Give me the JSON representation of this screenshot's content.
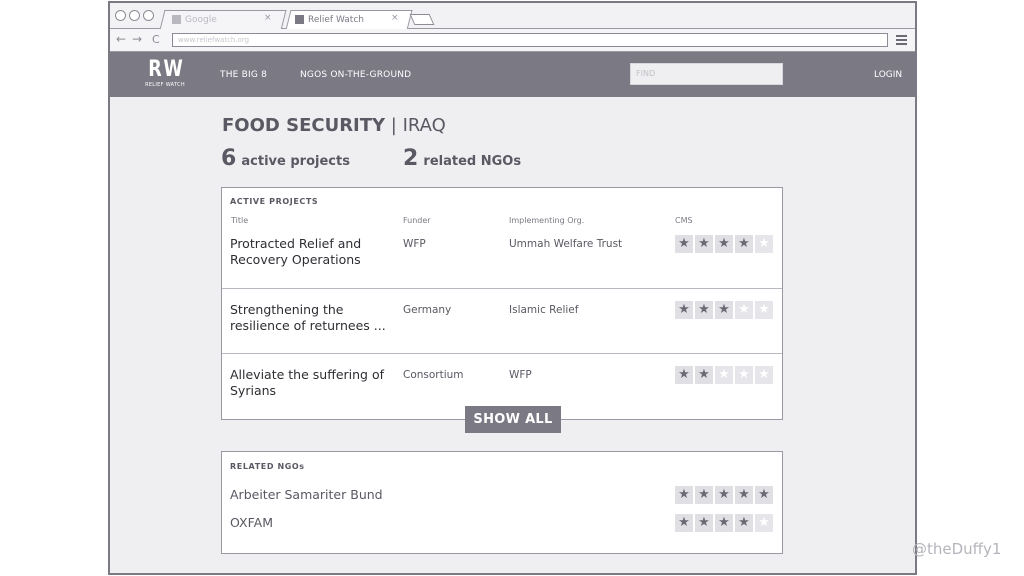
{
  "browser": {
    "tabs": [
      {
        "label": "Google",
        "close": "×"
      },
      {
        "label": "Relief Watch",
        "close": "×"
      }
    ],
    "url": "www.reliefwatch.org",
    "back": "←",
    "forward": "→",
    "reload": "C"
  },
  "site": {
    "logo": "RW",
    "logo_sub": "RELIEF WATCH",
    "nav": [
      "THE BIG 8",
      "NGOS ON-THE-GROUND"
    ],
    "find_placeholder": "FIND",
    "login": "LOGIN"
  },
  "page": {
    "title_bold": "FOOD SECURITY",
    "title_sep": " | ",
    "title_country": "IRAQ",
    "stats": [
      {
        "num": "6",
        "label": "active projects"
      },
      {
        "num": "2",
        "label": "related NGOs"
      }
    ]
  },
  "projects": {
    "heading": "ACTIVE PROJECTS",
    "columns": [
      "Title",
      "Funder",
      "Implementing Org.",
      "CMS"
    ],
    "rows": [
      {
        "title": "Protracted Relief and Recovery Operations",
        "funder": "WFP",
        "org": "Ummah Welfare Trust",
        "rating": 4
      },
      {
        "title": "Strengthening the resilience of returnees ...",
        "funder": "Germany",
        "org": "Islamic Relief",
        "rating": 3
      },
      {
        "title": "Alleviate the suffering of Syrians",
        "funder": "Consortium",
        "org": "WFP",
        "rating": 2
      }
    ],
    "show_all": "SHOW ALL"
  },
  "ngos": {
    "heading": "RELATED NGOs",
    "items": [
      {
        "name": "Arbeiter Samariter Bund",
        "rating": 5
      },
      {
        "name": "OXFAM",
        "rating": 4
      }
    ]
  },
  "rating_max": 5,
  "star_glyph": "★",
  "credit": "@theDuffy1",
  "colors": {
    "nav_bg": "#7b7984",
    "star_filled": "#6b6973",
    "star_empty": "#ffffff"
  }
}
